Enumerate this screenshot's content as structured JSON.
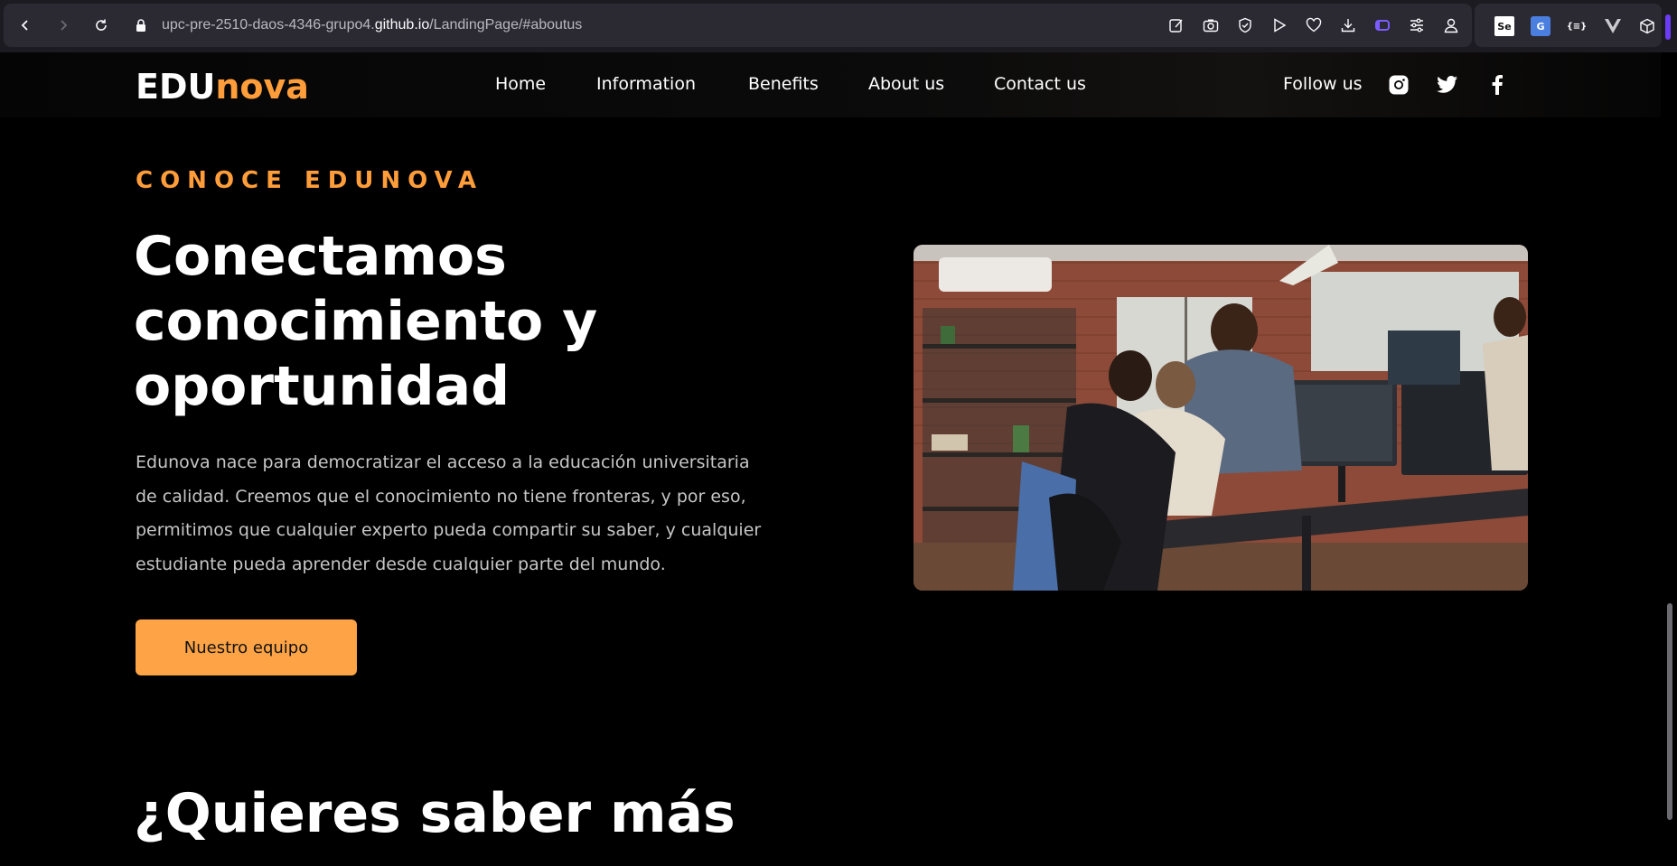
{
  "browser": {
    "url_prefix": "upc-pre-2510-daos-4346-grupo4.",
    "url_domain": "github.io",
    "url_path": "/LandingPage/#aboutus",
    "toolbar_icons": [
      "edit-icon",
      "camera-icon",
      "shield-icon",
      "play-icon",
      "heart-icon",
      "download-icon",
      "tab-icon",
      "sliders-icon",
      "account-icon"
    ],
    "extensions": [
      "Se",
      "G",
      "{≡}"
    ]
  },
  "site": {
    "logo_part1": "EDU",
    "logo_part2": "nova",
    "accent_color": "#ff9d3a",
    "nav": {
      "home": "Home",
      "information": "Information",
      "benefits": "Benefits",
      "about": "About us",
      "contact": "Contact us"
    },
    "follow_label": "Follow us",
    "social_icons": [
      "instagram-icon",
      "twitter-icon",
      "facebook-icon"
    ]
  },
  "about": {
    "eyebrow": "CONOCE EDUNOVA",
    "headline": "Conectamos conocimiento y oportunidad",
    "description": "Edunova nace para democratizar el acceso a la educación universitaria de calidad. Creemos que el conocimiento no tiene fronteras, y por eso, permitimos que cualquier experto pueda compartir su saber, y cualquier estudiante pueda aprender desde cualquier parte del mundo.",
    "cta_label": "Nuestro equipo"
  },
  "next_section": {
    "heading": "¿Quieres saber más"
  }
}
